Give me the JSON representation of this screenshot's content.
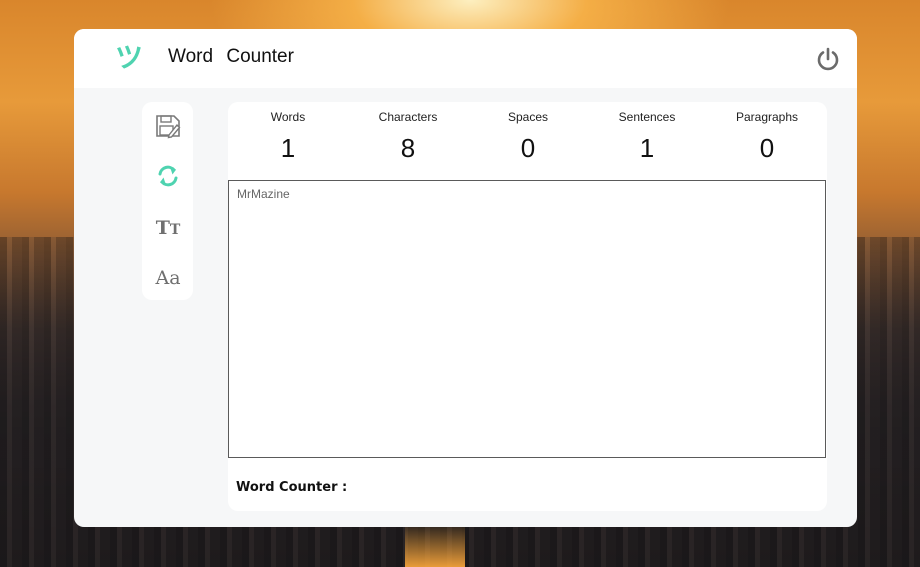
{
  "app": {
    "title": "Word Counter",
    "title_word1": "Word",
    "title_word2": "Counter",
    "logo_glyph": "ツ",
    "accent_color": "#4fd3b0"
  },
  "toolbar": {
    "items": [
      {
        "icon": "save-icon"
      },
      {
        "icon": "refresh-icon"
      },
      {
        "icon": "text-size-icon",
        "glyph": "Tт"
      },
      {
        "icon": "font-case-icon",
        "glyph": "Aa"
      }
    ]
  },
  "stats": [
    {
      "label": "Words",
      "value": "1"
    },
    {
      "label": "Characters",
      "value": "8"
    },
    {
      "label": "Spaces",
      "value": "0"
    },
    {
      "label": "Sentences",
      "value": "1"
    },
    {
      "label": "Paragraphs",
      "value": "0"
    }
  ],
  "editor": {
    "value": "MrMazine"
  },
  "footer": {
    "label": "Word Counter :"
  }
}
